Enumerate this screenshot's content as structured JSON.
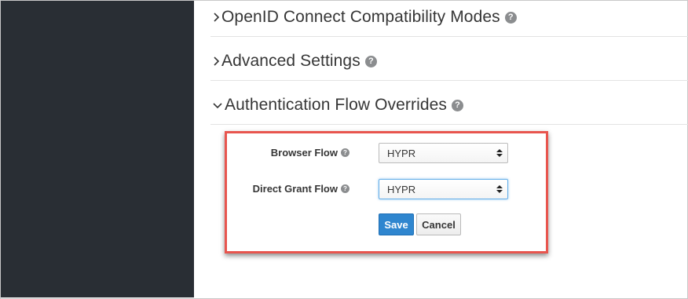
{
  "sections": [
    {
      "title": "OpenID Connect Compatibility Modes",
      "expanded": false,
      "help_icon": "question-circle-icon"
    },
    {
      "title": "Advanced Settings",
      "expanded": false,
      "help_icon": "question-circle-icon"
    },
    {
      "title": "Authentication Flow Overrides",
      "expanded": true,
      "help_icon": "question-circle-icon"
    }
  ],
  "form": {
    "browser_flow": {
      "label": "Browser Flow",
      "value": "HYPR"
    },
    "direct_grant_flow": {
      "label": "Direct Grant Flow",
      "value": "HYPR"
    },
    "save_label": "Save",
    "cancel_label": "Cancel"
  },
  "colors": {
    "sidebar": "#292e34",
    "highlight_border": "#e8554e",
    "primary_button": "#2f86cf"
  }
}
